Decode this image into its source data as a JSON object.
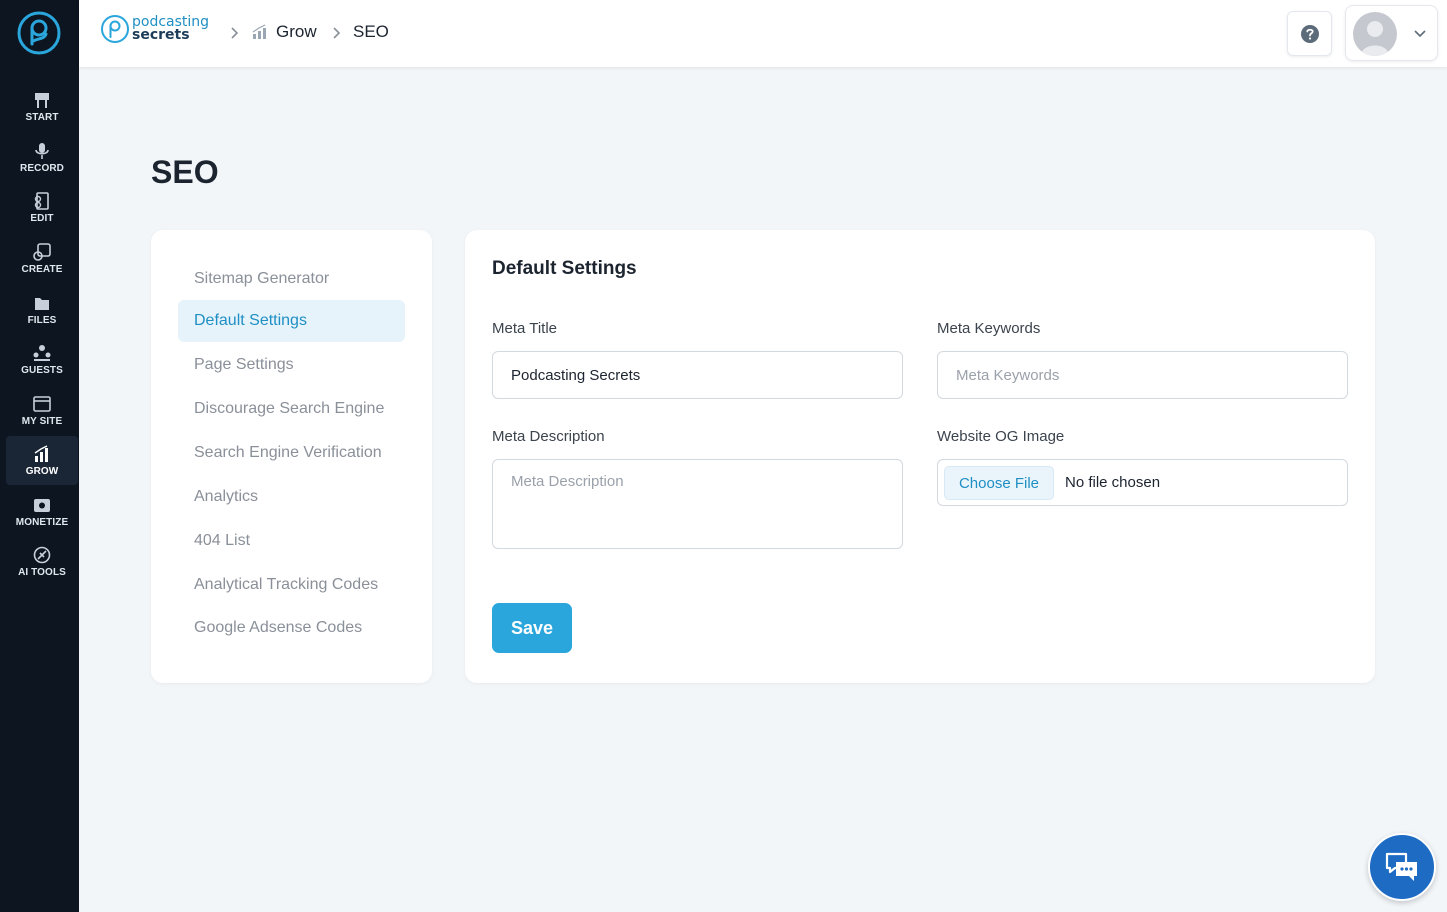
{
  "sidebar": {
    "items": [
      {
        "key": "start",
        "label": "START",
        "icon": "start-icon"
      },
      {
        "key": "record",
        "label": "RECORD",
        "icon": "microphone-icon"
      },
      {
        "key": "edit",
        "label": "EDIT",
        "icon": "edit-icon"
      },
      {
        "key": "create",
        "label": "CREATE",
        "icon": "create-icon"
      },
      {
        "key": "files",
        "label": "FILES",
        "icon": "files-icon"
      },
      {
        "key": "guests",
        "label": "GUESTS",
        "icon": "guests-icon"
      },
      {
        "key": "mysite",
        "label": "MY SITE",
        "icon": "browser-icon"
      },
      {
        "key": "grow",
        "label": "GROW",
        "icon": "bar-chart-icon",
        "active": true
      },
      {
        "key": "monetize",
        "label": "MONETIZE",
        "icon": "monetize-icon"
      },
      {
        "key": "aitools",
        "label": "AI TOOLS",
        "icon": "ai-tools-icon"
      }
    ]
  },
  "header": {
    "brand_line1": "podcasting",
    "brand_line2": "secrets",
    "breadcrumb": [
      "Grow",
      "SEO"
    ]
  },
  "page": {
    "title": "SEO"
  },
  "seo_menu": {
    "items": [
      "Sitemap Generator",
      "Default Settings",
      "Page Settings",
      "Discourage Search Engine",
      "Search Engine Verification",
      "Analytics",
      "404 List",
      "Analytical Tracking Codes",
      "Google Adsense Codes"
    ],
    "active_index": 1
  },
  "form": {
    "title": "Default Settings",
    "meta_title_label": "Meta Title",
    "meta_title_value": "Podcasting Secrets",
    "meta_keywords_label": "Meta Keywords",
    "meta_keywords_placeholder": "Meta Keywords",
    "meta_description_label": "Meta Description",
    "meta_description_placeholder": "Meta Description",
    "og_image_label": "Website OG Image",
    "choose_file_label": "Choose File",
    "no_file_text": "No file chosen",
    "save_label": "Save"
  },
  "colors": {
    "accent": "#2aa6dc",
    "sidebar_bg": "#0c1520",
    "active_menu_bg": "#e6f3fb",
    "chat_button": "#1e6bc4"
  }
}
